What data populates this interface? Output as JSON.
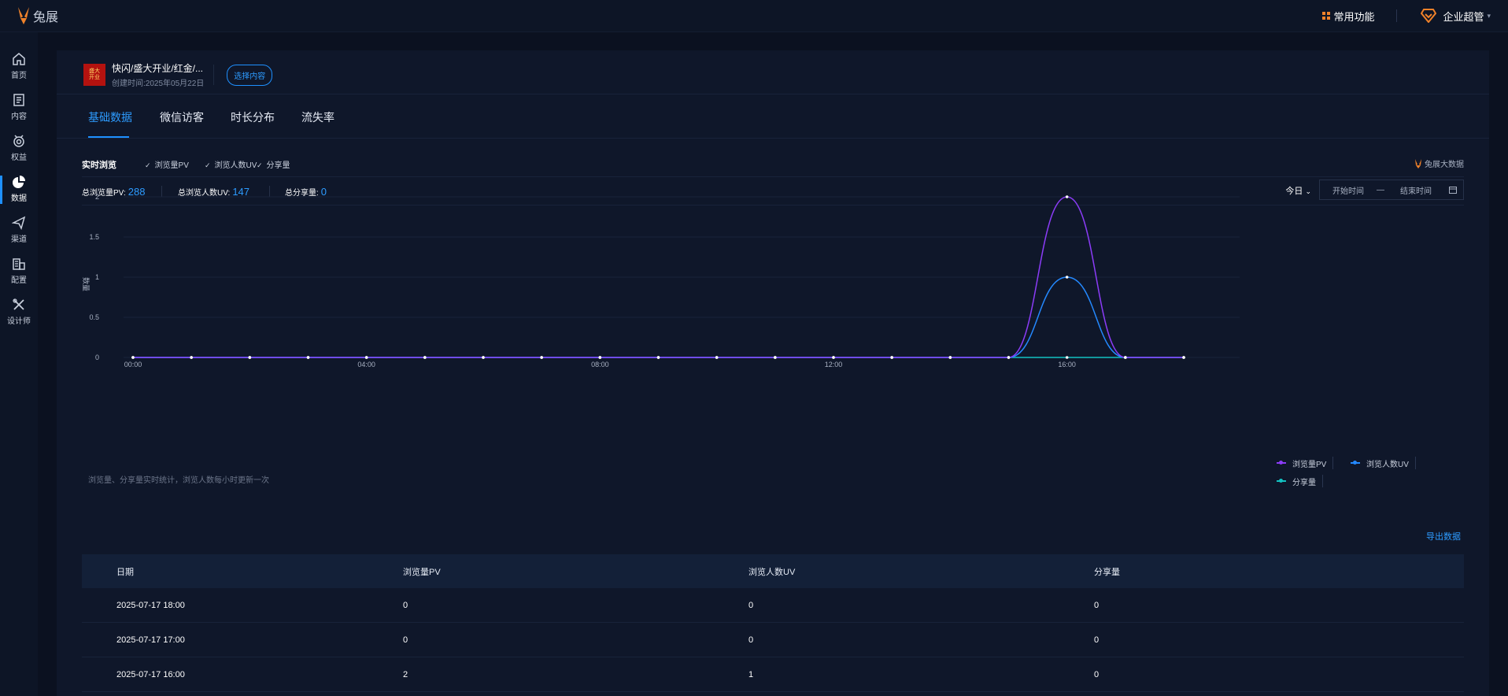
{
  "brand": {
    "name": "兔展"
  },
  "topbar": {
    "common_label": "常用功能",
    "user_label": "企业超管"
  },
  "sidebar": {
    "items": [
      {
        "label": "首页",
        "icon": "home-icon"
      },
      {
        "label": "内容",
        "icon": "document-icon"
      },
      {
        "label": "权益",
        "icon": "medal-icon"
      },
      {
        "label": "数据",
        "icon": "pie-chart-icon",
        "active": true
      },
      {
        "label": "渠道",
        "icon": "paper-plane-icon"
      },
      {
        "label": "配置",
        "icon": "building-icon"
      },
      {
        "label": "设计师",
        "icon": "tools-icon"
      }
    ]
  },
  "content": {
    "title": "快闪/盛大开业/红金/...",
    "created": "创建时间:2025年05月22日",
    "select_label": "选择内容"
  },
  "tabs": [
    {
      "label": "基础数据",
      "active": true
    },
    {
      "label": "微信访客"
    },
    {
      "label": "时长分布"
    },
    {
      "label": "流失率"
    }
  ],
  "realtime": {
    "title": "实时浏览",
    "checkboxes": [
      "浏览量PV",
      "浏览人数UV",
      "分享量"
    ],
    "brand_label": "兔展大数据"
  },
  "stats": {
    "pv_label": "总浏览量PV:",
    "pv_value": "288",
    "uv_label": "总浏览人数UV:",
    "uv_value": "147",
    "share_label": "总分享量:",
    "share_value": "0",
    "period_label": "今日",
    "start_placeholder": "开始时间",
    "range_sep": "—",
    "end_placeholder": "结束时间"
  },
  "chart_data": {
    "type": "line",
    "ylabel": "数量",
    "ylim": [
      0,
      2
    ],
    "yticks": [
      "0",
      "0.5",
      "1",
      "1.5",
      "2"
    ],
    "x": [
      "00:00",
      "01:00",
      "02:00",
      "03:00",
      "04:00",
      "05:00",
      "06:00",
      "07:00",
      "08:00",
      "09:00",
      "10:00",
      "11:00",
      "12:00",
      "13:00",
      "14:00",
      "15:00",
      "16:00",
      "17:00",
      "18:00"
    ],
    "xticks": [
      "00:00",
      "04:00",
      "08:00",
      "12:00",
      "16:00"
    ],
    "series": [
      {
        "name": "浏览量PV",
        "color": "#8b3cf7",
        "values": [
          0,
          0,
          0,
          0,
          0,
          0,
          0,
          0,
          0,
          0,
          0,
          0,
          0,
          0,
          0,
          0,
          2,
          0,
          0
        ]
      },
      {
        "name": "浏览人数UV",
        "color": "#2489ff",
        "values": [
          0,
          0,
          0,
          0,
          0,
          0,
          0,
          0,
          0,
          0,
          0,
          0,
          0,
          0,
          0,
          0,
          1,
          0,
          0
        ]
      },
      {
        "name": "分享量",
        "color": "#13c2c2",
        "values": [
          0,
          0,
          0,
          0,
          0,
          0,
          0,
          0,
          0,
          0,
          0,
          0,
          0,
          0,
          0,
          0,
          0,
          0,
          0
        ]
      }
    ],
    "grid": true,
    "legend_position": "bottom-right"
  },
  "chart_hint": "浏览量、分享量实时统计，浏览人数每小时更新一次",
  "export_label": "导出数据",
  "table": {
    "headers": [
      "日期",
      "浏览量PV",
      "浏览人数UV",
      "分享量"
    ],
    "rows": [
      [
        "2025-07-17 18:00",
        "0",
        "0",
        "0"
      ],
      [
        "2025-07-17 17:00",
        "0",
        "0",
        "0"
      ],
      [
        "2025-07-17 16:00",
        "2",
        "1",
        "0"
      ]
    ]
  },
  "colors": {
    "accent": "#1e90ff",
    "background": "#0b1120",
    "panel": "#0f172a",
    "logo": "#f0822a"
  }
}
